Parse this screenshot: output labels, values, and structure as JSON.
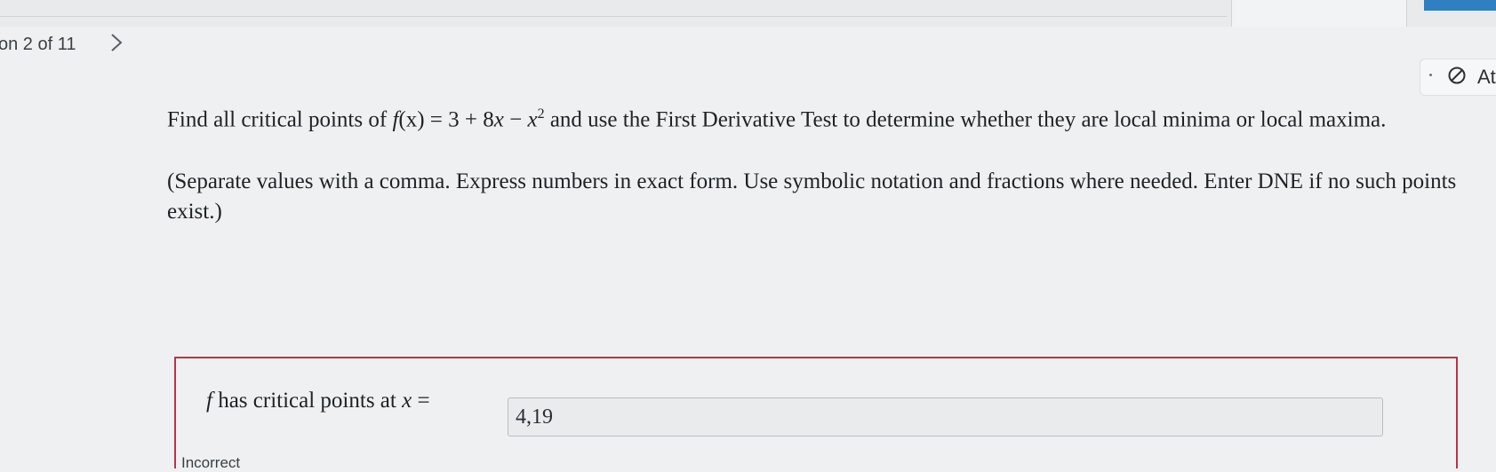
{
  "nav": {
    "question_counter": "on 2 of 11",
    "next_icon": "chevron-right-icon"
  },
  "attempt": {
    "label": "At",
    "icon": "no-entry-icon"
  },
  "question": {
    "prompt_before": "Find all critical points of ",
    "function_name": "f",
    "function_arg": "(x)",
    "equals": " = 3 + 8",
    "var_x": "x",
    "minus": " − ",
    "var_x2": "x",
    "exponent": "2",
    "prompt_after": " and use the First Derivative Test to determine whether they are local minima or local maxima.",
    "instructions": "(Separate values with a comma. Express numbers in exact form. Use symbolic notation and fractions where needed. Enter DNE if no such points exist.)"
  },
  "answer": {
    "label_f": "f",
    "label_text": " has critical points at ",
    "label_x": "x",
    "label_eq": " =",
    "value": "4,19",
    "status": "Incorrect",
    "status_color": "#b8334a"
  }
}
